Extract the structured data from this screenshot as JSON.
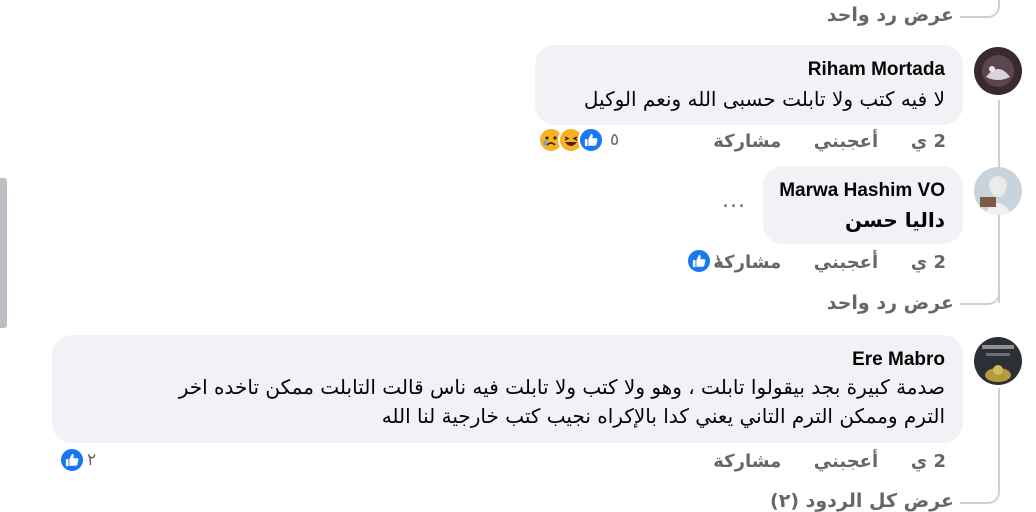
{
  "top_view_reply": "عرض رد واحد",
  "comments": [
    {
      "author": "Riham Mortada",
      "text_lines": [
        "لا فيه كتب ولا تابلت حسبى الله ونعم الوكيل"
      ],
      "time": "2 ي",
      "like_label": "أعجبني",
      "share_label": "مشاركة",
      "reaction_count": "٥"
    },
    {
      "author": "Marwa Hashim VO",
      "text_lines": [
        "داليا حسن"
      ],
      "more": "...",
      "time": "2 ي",
      "like_label": "أعجبني",
      "share_label": "مشاركة",
      "reaction_count": "١",
      "view_reply": "عرض رد واحد"
    },
    {
      "author": "Ere Mabro",
      "text_lines": [
        "صدمة كبيرة بجد بيقولوا تابلت ، وهو ولا كتب ولا تابلت فيه ناس قالت التابلت ممكن تاخده اخر",
        "الترم وممكن الترم التاني يعني كدا بالإكراه نجيب كتب خارجية لنا الله"
      ],
      "time": "2 ي",
      "like_label": "أعجبني",
      "share_label": "مشاركة",
      "reaction_count": "٢",
      "view_all_replies": "عرض كل الردود (٢)"
    }
  ],
  "colors": {
    "bubble": "#f0f2f5",
    "secondary_text": "#65676b",
    "like_blue": "#1877f2",
    "thread_line": "#ced0d4"
  },
  "icons": [
    "like-icon",
    "haha-icon",
    "sad-icon",
    "more-icon"
  ]
}
